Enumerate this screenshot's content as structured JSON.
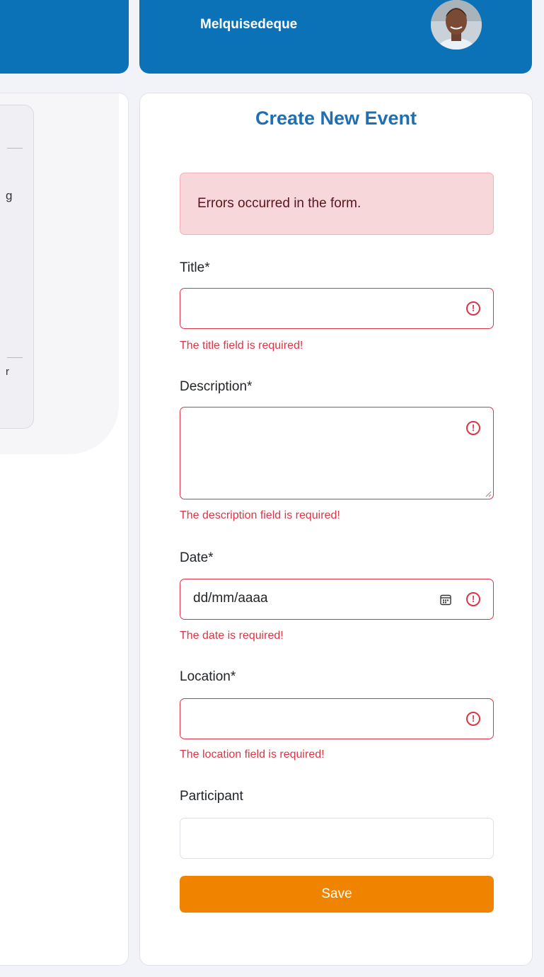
{
  "header": {
    "username": "Melquisedeque"
  },
  "sidebar": {
    "glyph_1": "g",
    "glyph_2": "r"
  },
  "form": {
    "title": "Create New Event",
    "alert": "Errors occurred in the form.",
    "fields": {
      "title": {
        "label": "Title*",
        "value": "",
        "error": "The title field is required!"
      },
      "description": {
        "label": "Description*",
        "value": "",
        "error": "The description field is required!"
      },
      "date": {
        "label": "Date*",
        "placeholder": "dd/mm/aaaa",
        "error": "The date is required!"
      },
      "location": {
        "label": "Location*",
        "value": "",
        "error": "The location field is required!"
      },
      "participant": {
        "label": "Participant",
        "value": ""
      }
    },
    "save_label": "Save"
  },
  "icons": {
    "error": "exclamation-circle-icon",
    "calendar": "calendar-icon",
    "avatar": "user-avatar"
  },
  "colors": {
    "primary": "#0b72b8",
    "title": "#1f6fb2",
    "danger": "#dc3545",
    "alert_bg": "#f8d7da",
    "save": "#f08400"
  }
}
